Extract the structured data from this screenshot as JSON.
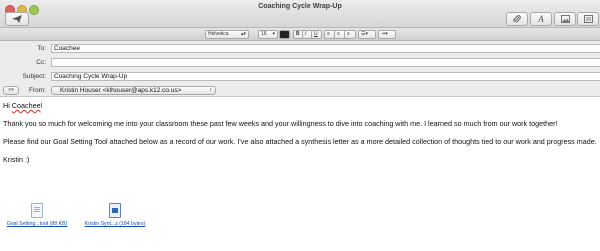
{
  "window": {
    "title": "Coaching Cycle Wrap-Up"
  },
  "format_bar": {
    "font": "Helvetica",
    "size": "16"
  },
  "header": {
    "to_label": "To:",
    "to_value": "Coachee",
    "cc_label": "Cc:",
    "cc_value": "",
    "subject_label": "Subject:",
    "subject_value": "Coaching Cycle Wrap-Up",
    "from_label": "From:",
    "from_value": "Kristin Houser <klhouser@aps.k12.co.us>"
  },
  "body": {
    "greeting_hi": "Hi ",
    "greeting_name": "Coachee",
    "greeting_end": "!",
    "paragraph1": "Thank you so much for welcoming me into your classroom these past few weeks and your willingness to dive into coaching with me. I learned so much from our work together!",
    "paragraph2": "Please find our Goal Setting Tool attached below as a record of our work.  I've also attached a synthesis letter as a more detailed collection of thoughts tied to our work and progress made.",
    "signoff": "Kristin :)"
  },
  "attachments": [
    {
      "label": "Goal Setting...trait (88 KB)"
    },
    {
      "label": "Kristin Synt...z (184 bytes)"
    }
  ]
}
